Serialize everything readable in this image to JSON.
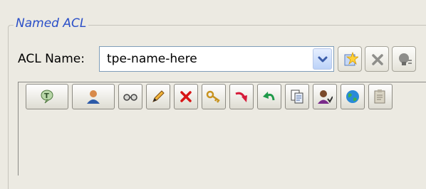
{
  "group": {
    "title": "Named ACL"
  },
  "acl_name": {
    "label": "ACL Name:",
    "value": "tpe-name-here"
  },
  "icons": {
    "new": "new-star-icon",
    "delete": "delete-x-icon",
    "properties": "lightbulb-icon"
  },
  "toolbar_icons": [
    "text-token-icon",
    "user-icon",
    "glasses-icon",
    "pencil-icon",
    "red-x-icon",
    "key-icon",
    "redo-arrow-icon",
    "undo-arrow-icon",
    "copy-icon",
    "user-permission-icon",
    "globe-icon",
    "clipboard-icon"
  ]
}
